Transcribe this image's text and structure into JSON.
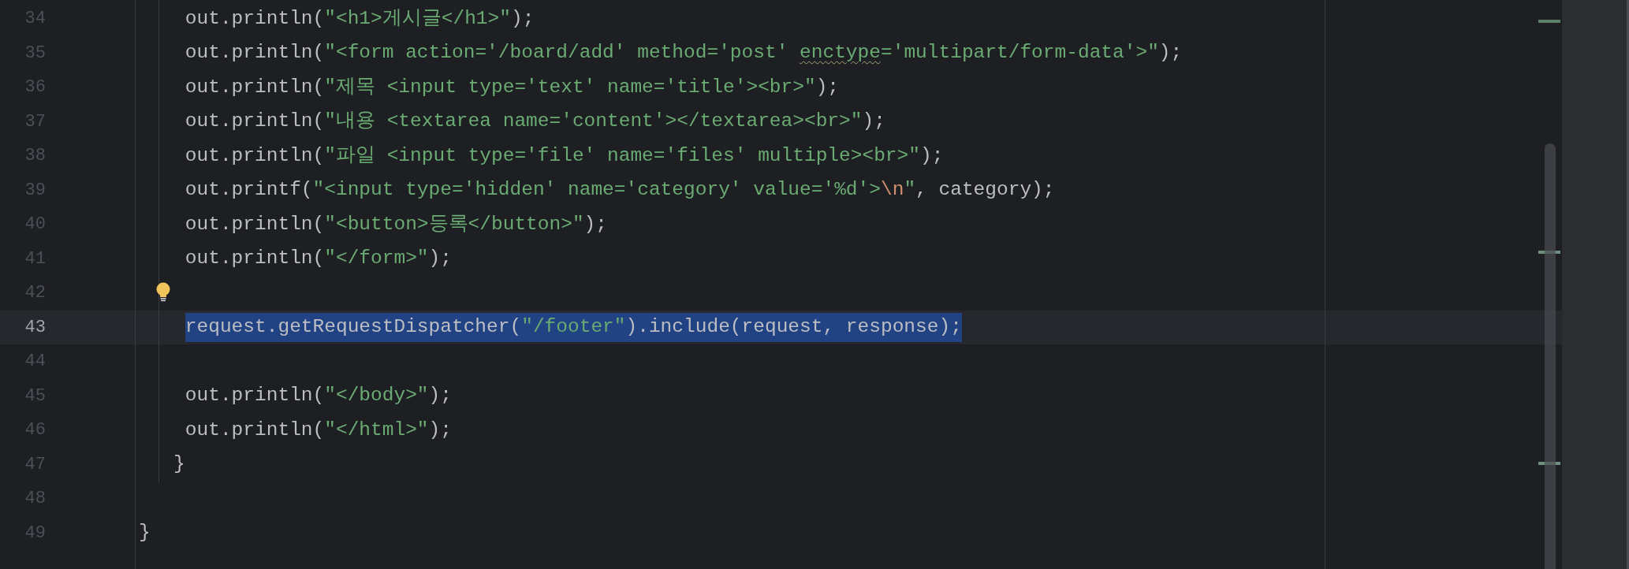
{
  "lines": [
    {
      "number": "34",
      "selected": false,
      "bulb": false,
      "segments": [
        {
          "kind": "plain",
          "text": "    out.println("
        },
        {
          "kind": "string",
          "text": "\"<h1>게시글</h1>\""
        },
        {
          "kind": "plain",
          "text": ");"
        }
      ]
    },
    {
      "number": "35",
      "selected": false,
      "bulb": false,
      "segments": [
        {
          "kind": "plain",
          "text": "    out.println("
        },
        {
          "kind": "string",
          "text": "\"<form action='/board/add' method='post' "
        },
        {
          "kind": "warning",
          "text": "enctype"
        },
        {
          "kind": "string",
          "text": "='multipart/form-data'>\""
        },
        {
          "kind": "plain",
          "text": ");"
        }
      ]
    },
    {
      "number": "36",
      "selected": false,
      "bulb": false,
      "segments": [
        {
          "kind": "plain",
          "text": "    out.println("
        },
        {
          "kind": "string",
          "text": "\"제목 <input type='text' name='title'><br>\""
        },
        {
          "kind": "plain",
          "text": ");"
        }
      ]
    },
    {
      "number": "37",
      "selected": false,
      "bulb": false,
      "segments": [
        {
          "kind": "plain",
          "text": "    out.println("
        },
        {
          "kind": "string",
          "text": "\"내용 <textarea name='content'></textarea><br>\""
        },
        {
          "kind": "plain",
          "text": ");"
        }
      ]
    },
    {
      "number": "38",
      "selected": false,
      "bulb": false,
      "segments": [
        {
          "kind": "plain",
          "text": "    out.println("
        },
        {
          "kind": "string",
          "text": "\"파일 <input type='file' name='files' multiple><br>\""
        },
        {
          "kind": "plain",
          "text": ");"
        }
      ]
    },
    {
      "number": "39",
      "selected": false,
      "bulb": false,
      "segments": [
        {
          "kind": "plain",
          "text": "    out.printf("
        },
        {
          "kind": "string",
          "text": "\"<input type='hidden' name='category' value='%d'>"
        },
        {
          "kind": "escape",
          "text": "\\n"
        },
        {
          "kind": "string",
          "text": "\""
        },
        {
          "kind": "plain",
          "text": ", category);"
        }
      ]
    },
    {
      "number": "40",
      "selected": false,
      "bulb": false,
      "segments": [
        {
          "kind": "plain",
          "text": "    out.println("
        },
        {
          "kind": "string",
          "text": "\"<button>등록</button>\""
        },
        {
          "kind": "plain",
          "text": ");"
        }
      ]
    },
    {
      "number": "41",
      "selected": false,
      "bulb": false,
      "segments": [
        {
          "kind": "plain",
          "text": "    out.println("
        },
        {
          "kind": "string",
          "text": "\"</form>\""
        },
        {
          "kind": "plain",
          "text": ");"
        }
      ]
    },
    {
      "number": "42",
      "selected": false,
      "bulb": true
    },
    {
      "number": "43",
      "selected": true,
      "bulb": false,
      "segments": [
        {
          "kind": "plain",
          "text": "    request.getRequestDispatcher("
        },
        {
          "kind": "string",
          "text": "\"/footer\""
        },
        {
          "kind": "plain",
          "text": ").include(request, response);"
        }
      ]
    },
    {
      "number": "44",
      "selected": false,
      "bulb": false
    },
    {
      "number": "45",
      "selected": false,
      "bulb": false,
      "segments": [
        {
          "kind": "plain",
          "text": "    out.println("
        },
        {
          "kind": "string",
          "text": "\"</body>\""
        },
        {
          "kind": "plain",
          "text": ");"
        }
      ]
    },
    {
      "number": "46",
      "selected": false,
      "bulb": false,
      "segments": [
        {
          "kind": "plain",
          "text": "    out.println("
        },
        {
          "kind": "string",
          "text": "\"</html>\""
        },
        {
          "kind": "plain",
          "text": ");"
        }
      ]
    },
    {
      "number": "47",
      "selected": false,
      "bulb": false,
      "segments": [
        {
          "kind": "plain",
          "text": "   }"
        }
      ]
    },
    {
      "number": "48",
      "selected": false,
      "bulb": false
    },
    {
      "number": "49",
      "selected": false,
      "bulb": false,
      "segments": [
        {
          "kind": "plain",
          "text": "}"
        }
      ]
    }
  ]
}
